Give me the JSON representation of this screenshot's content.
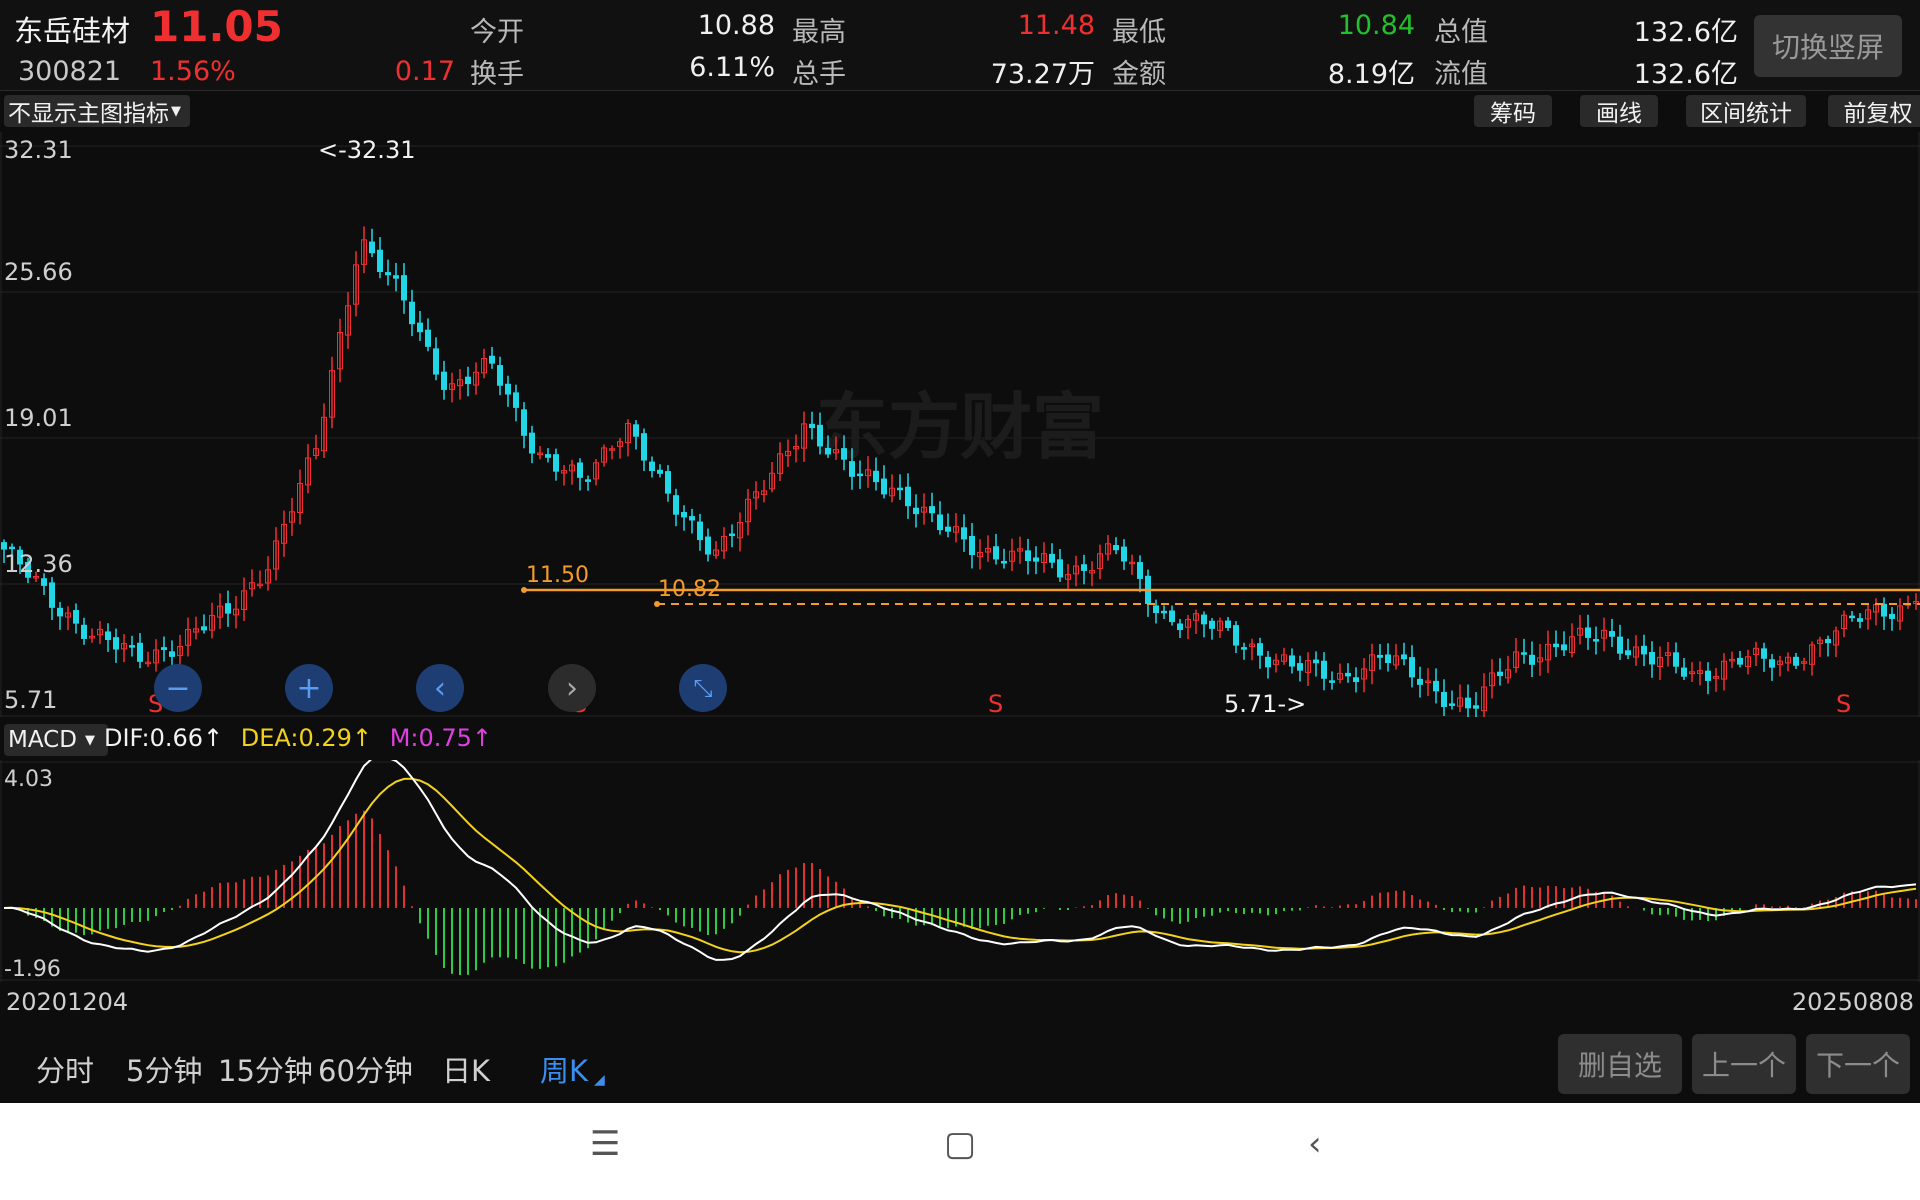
{
  "header": {
    "stock_name": "东岳硅材",
    "price": "11.05",
    "code": "300821",
    "change_pct": "1.56%",
    "change": "0.17",
    "open_label": "今开",
    "open_value": "10.88",
    "high_label": "最高",
    "high_value": "11.48",
    "low_label": "最低",
    "low_value": "10.84",
    "mcap_label": "总值",
    "mcap_value": "132.6亿",
    "turnover_label": "换手",
    "turnover_value": "6.11%",
    "volume_label": "总手",
    "volume_value": "73.27万",
    "amount_label": "金额",
    "amount_value": "8.19亿",
    "float_label": "流值",
    "float_value": "132.6亿",
    "switch_label": "切换竖屏"
  },
  "toolbar": {
    "indicator_select": "不显示主图指标",
    "chips": "筹码",
    "draw": "画线",
    "range_stats": "区间统计",
    "adjust": "前复权"
  },
  "main_chart": {
    "watermark": "东方财富",
    "y_ticks": [
      "32.31",
      "25.66",
      "19.01",
      "12.36",
      "5.71"
    ],
    "high_marker": "<-32.31",
    "low_marker": "5.71->",
    "line1_label": "11.50",
    "line2_label": "10.82",
    "signal": "S",
    "buttons": {
      "zoom_out": "−",
      "zoom_in": "+",
      "prev": "‹",
      "next": "›",
      "fit": "⤡"
    }
  },
  "macd": {
    "select": "MACD",
    "dif": "DIF:0.66",
    "dea": "DEA:0.29",
    "m": "M:0.75",
    "arrow": "↑",
    "y_top": "4.03",
    "y_bottom": "-1.96"
  },
  "dates": {
    "start": "20201204",
    "end": "20250808"
  },
  "periods": [
    "分时",
    "5分钟",
    "15分钟",
    "60分钟",
    "日K",
    "周K"
  ],
  "active_period": "周K",
  "actions": {
    "delete": "删自选",
    "prev": "上一个",
    "next": "下一个"
  },
  "colors": {
    "up": "#f03030",
    "down": "#22d6e6",
    "dif": "#ffffff",
    "dea": "#f2d21c",
    "m": "#e040e0",
    "line": "#f39c2a"
  },
  "chart_data": {
    "type": "candlestick",
    "ylim": [
      5.71,
      32.31
    ],
    "close_samples": [
      {
        "x": "20201204",
        "y": 13.5
      },
      {
        "y": 11.2
      },
      {
        "y": 9.5
      },
      {
        "y": 8.4
      },
      {
        "y": 9.2
      },
      {
        "y": 10.5
      },
      {
        "y": 13.0
      },
      {
        "y": 18.0
      },
      {
        "y": 28.0
      },
      {
        "y": 25.0
      },
      {
        "y": 21.0
      },
      {
        "y": 22.0
      },
      {
        "y": 18.0
      },
      {
        "y": 16.5
      },
      {
        "y": 19.5
      },
      {
        "y": 15.5
      },
      {
        "y": 13.5
      },
      {
        "y": 16.0
      },
      {
        "y": 19.5
      },
      {
        "y": 17.0
      },
      {
        "y": 16.5
      },
      {
        "y": 14.5
      },
      {
        "y": 13.5
      },
      {
        "y": 13.0
      },
      {
        "y": 12.5
      },
      {
        "y": 13.5
      },
      {
        "y": 10.5
      },
      {
        "y": 10.0
      },
      {
        "y": 9.0
      },
      {
        "y": 8.0
      },
      {
        "y": 7.5
      },
      {
        "y": 8.5
      },
      {
        "y": 7.2
      },
      {
        "y": 6.0
      },
      {
        "y": 8.5
      },
      {
        "y": 9.0
      },
      {
        "y": 9.5
      },
      {
        "y": 8.5
      },
      {
        "y": 7.5
      },
      {
        "y": 8.5
      },
      {
        "y": 8.0
      },
      {
        "y": 9.5
      },
      {
        "y": 10.5
      },
      {
        "y": 11.05,
        "x": "20250808"
      }
    ]
  }
}
